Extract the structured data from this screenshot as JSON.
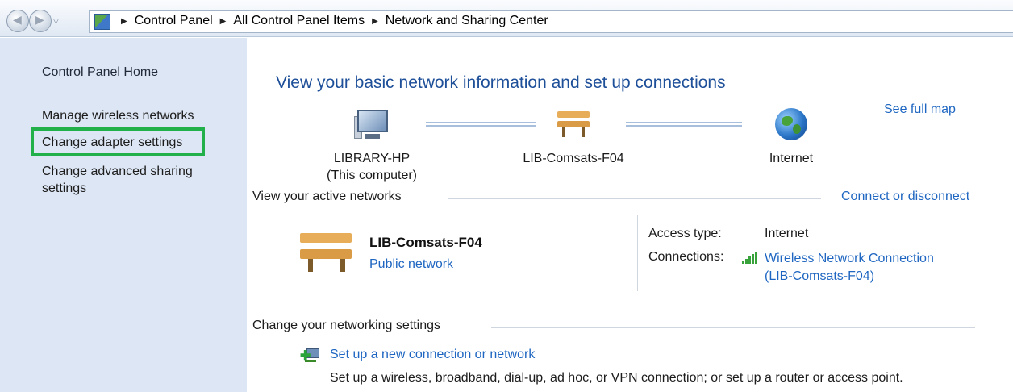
{
  "address_bar": {
    "breadcrumbs": [
      "Control Panel",
      "All Control Panel Items",
      "Network and Sharing Center"
    ]
  },
  "left_pane": {
    "home": "Control Panel Home",
    "links": [
      "Manage wireless networks",
      "Change adapter settings",
      "Change advanced sharing settings"
    ],
    "highlighted_link": "Change adapter settings",
    "highlight_color": "#22b04b"
  },
  "main": {
    "heading": "View your basic network information and set up connections",
    "see_full_map": "See full map",
    "map": {
      "computer_name": "LIBRARY-HP",
      "computer_sub": "(This computer)",
      "network_name": "LIB-Comsats-F04",
      "internet": "Internet"
    },
    "active_networks_title": "View your active networks",
    "connect_or_disconnect": "Connect or disconnect",
    "active_network": {
      "name": "LIB-Comsats-F04",
      "category": "Public network",
      "access_type_label": "Access type:",
      "access_type_value": "Internet",
      "connections_label": "Connections:",
      "connection_name": "Wireless Network Connection",
      "connection_ssid": "(LIB-Comsats-F04)"
    },
    "change_settings_title": "Change your networking settings",
    "setup": {
      "link": "Set up a new connection or network",
      "description": "Set up a wireless, broadband, dial-up, ad hoc, or VPN connection; or set up a router or access point."
    }
  },
  "colors": {
    "link": "#1e66c1",
    "heading": "#1e4f99",
    "left_pane_bg": "#dde6f4"
  }
}
